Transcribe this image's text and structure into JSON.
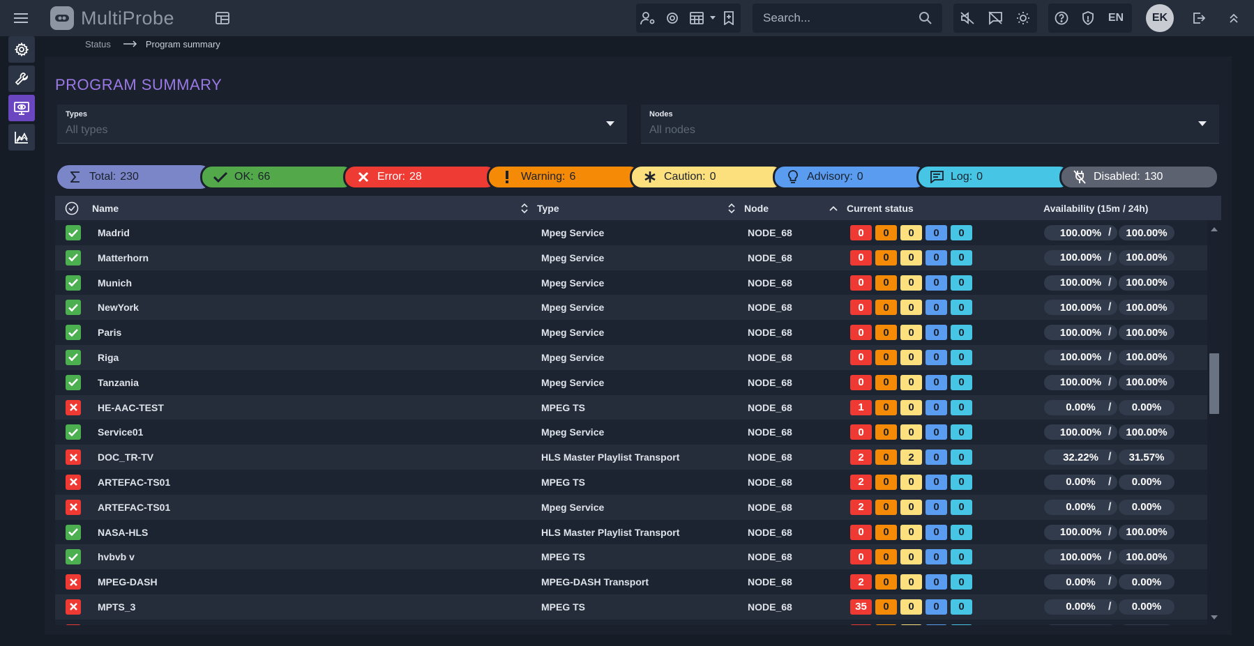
{
  "app": {
    "logo_text": "MultiProbe"
  },
  "search": {
    "placeholder": "Search..."
  },
  "header": {
    "language": "EN",
    "user_initials": "EK"
  },
  "breadcrumb": {
    "parent": "Status",
    "current": "Program summary"
  },
  "page": {
    "title": "PROGRAM SUMMARY"
  },
  "filters": {
    "types": {
      "label": "Types",
      "value": "All types"
    },
    "nodes": {
      "label": "Nodes",
      "value": "All nodes"
    }
  },
  "summary": {
    "total": {
      "label": "Total:",
      "value": "230"
    },
    "ok": {
      "label": "OK:",
      "value": "66"
    },
    "error": {
      "label": "Error:",
      "value": "28"
    },
    "warning": {
      "label": "Warning:",
      "value": "6"
    },
    "caution": {
      "label": "Caution:",
      "value": "0"
    },
    "advisory": {
      "label": "Advisory:",
      "value": "0"
    },
    "log": {
      "label": "Log:",
      "value": "0"
    },
    "disabled": {
      "label": "Disabled:",
      "value": "130"
    }
  },
  "table": {
    "columns": {
      "name": "Name",
      "type": "Type",
      "node": "Node",
      "current_status": "Current status",
      "availability": "Availability (15m / 24h)"
    },
    "rows": [
      {
        "status": "ok",
        "name": "Madrid",
        "type": "Mpeg Service",
        "node": "NODE_68",
        "counts": [
          "0",
          "0",
          "0",
          "0",
          "0"
        ],
        "av15": "100.00%",
        "av24": "100.00%"
      },
      {
        "status": "ok",
        "name": "Matterhorn",
        "type": "Mpeg Service",
        "node": "NODE_68",
        "counts": [
          "0",
          "0",
          "0",
          "0",
          "0"
        ],
        "av15": "100.00%",
        "av24": "100.00%"
      },
      {
        "status": "ok",
        "name": "Munich",
        "type": "Mpeg Service",
        "node": "NODE_68",
        "counts": [
          "0",
          "0",
          "0",
          "0",
          "0"
        ],
        "av15": "100.00%",
        "av24": "100.00%"
      },
      {
        "status": "ok",
        "name": "NewYork",
        "type": "Mpeg Service",
        "node": "NODE_68",
        "counts": [
          "0",
          "0",
          "0",
          "0",
          "0"
        ],
        "av15": "100.00%",
        "av24": "100.00%"
      },
      {
        "status": "ok",
        "name": "Paris",
        "type": "Mpeg Service",
        "node": "NODE_68",
        "counts": [
          "0",
          "0",
          "0",
          "0",
          "0"
        ],
        "av15": "100.00%",
        "av24": "100.00%"
      },
      {
        "status": "ok",
        "name": "Riga",
        "type": "Mpeg Service",
        "node": "NODE_68",
        "counts": [
          "0",
          "0",
          "0",
          "0",
          "0"
        ],
        "av15": "100.00%",
        "av24": "100.00%"
      },
      {
        "status": "ok",
        "name": "Tanzania",
        "type": "Mpeg Service",
        "node": "NODE_68",
        "counts": [
          "0",
          "0",
          "0",
          "0",
          "0"
        ],
        "av15": "100.00%",
        "av24": "100.00%"
      },
      {
        "status": "error",
        "name": "HE-AAC-TEST",
        "type": "MPEG TS",
        "node": "NODE_68",
        "counts": [
          "1",
          "0",
          "0",
          "0",
          "0"
        ],
        "av15": "0.00%",
        "av24": "0.00%"
      },
      {
        "status": "ok",
        "name": "Service01",
        "type": "Mpeg Service",
        "node": "NODE_68",
        "counts": [
          "0",
          "0",
          "0",
          "0",
          "0"
        ],
        "av15": "100.00%",
        "av24": "100.00%"
      },
      {
        "status": "error",
        "name": "DOC_TR-TV",
        "type": "HLS Master Playlist Transport",
        "node": "NODE_68",
        "counts": [
          "2",
          "0",
          "2",
          "0",
          "0"
        ],
        "av15": "32.22%",
        "av24": "31.57%"
      },
      {
        "status": "error",
        "name": "ARTEFAC-TS01",
        "type": "MPEG TS",
        "node": "NODE_68",
        "counts": [
          "2",
          "0",
          "0",
          "0",
          "0"
        ],
        "av15": "0.00%",
        "av24": "0.00%"
      },
      {
        "status": "error",
        "name": "ARTEFAC-TS01",
        "type": "Mpeg Service",
        "node": "NODE_68",
        "counts": [
          "2",
          "0",
          "0",
          "0",
          "0"
        ],
        "av15": "0.00%",
        "av24": "0.00%"
      },
      {
        "status": "ok",
        "name": "NASA-HLS",
        "type": "HLS Master Playlist Transport",
        "node": "NODE_68",
        "counts": [
          "0",
          "0",
          "0",
          "0",
          "0"
        ],
        "av15": "100.00%",
        "av24": "100.00%"
      },
      {
        "status": "ok",
        "name": "hvbvb v",
        "type": "MPEG TS",
        "node": "NODE_68",
        "counts": [
          "0",
          "0",
          "0",
          "0",
          "0"
        ],
        "av15": "100.00%",
        "av24": "100.00%"
      },
      {
        "status": "error",
        "name": "MPEG-DASH",
        "type": "MPEG-DASH Transport",
        "node": "NODE_68",
        "counts": [
          "2",
          "0",
          "0",
          "0",
          "0"
        ],
        "av15": "0.00%",
        "av24": "0.00%"
      },
      {
        "status": "error",
        "name": "MPTS_3",
        "type": "MPEG TS",
        "node": "NODE_68",
        "counts": [
          "35",
          "0",
          "0",
          "0",
          "0"
        ],
        "av15": "0.00%",
        "av24": "0.00%"
      },
      {
        "status": "error",
        "name": "",
        "type": "",
        "node": "",
        "counts": [
          "",
          "",
          "",
          "",
          ""
        ],
        "av15": "",
        "av24": ""
      }
    ]
  },
  "colors": {
    "accent": "#6b46c1",
    "title": "#9b7ae6",
    "ok": "#4caf50",
    "error": "#ef3a33",
    "warning": "#f58a07",
    "caution": "#fde07e",
    "advisory": "#5a9df0",
    "log": "#46c6e4",
    "disabled": "#5c6270"
  }
}
